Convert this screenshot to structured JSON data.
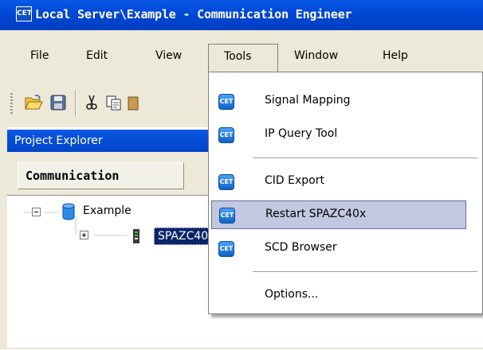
{
  "window": {
    "icon_text": "CET",
    "title": "Local Server\\Example - Communication Engineer"
  },
  "menubar": {
    "items": [
      {
        "label": "File"
      },
      {
        "label": "Edit"
      },
      {
        "label": "View"
      },
      {
        "label": "Tools"
      },
      {
        "label": "Window"
      },
      {
        "label": "Help"
      }
    ]
  },
  "toolbar": {
    "icons": [
      "open-folder-icon",
      "save-icon",
      "cut-icon",
      "copy-icon",
      "paste-icon"
    ]
  },
  "project_explorer": {
    "title": "Project Explorer",
    "close_glyph": "×",
    "tab_label": "Communication",
    "tree": [
      {
        "label": "Example",
        "expanded": true,
        "icon": "database-icon"
      },
      {
        "label": "SPAZC40x",
        "expanded": false,
        "selected": true,
        "icon": "device-icon"
      }
    ]
  },
  "tools_menu": {
    "items": [
      {
        "label": "Signal Mapping",
        "icon": "cet-icon",
        "icon_text": "CET"
      },
      {
        "label": "IP Query Tool",
        "icon": "cet-icon",
        "icon_text": "CET"
      },
      {
        "label": "CID Export",
        "icon": "cet-icon",
        "icon_text": "CET"
      },
      {
        "label": "Restart SPAZC40x",
        "icon": "cet-icon",
        "icon_text": "CET",
        "highlighted": true
      },
      {
        "label": "SCD Browser",
        "icon": "cet-icon",
        "icon_text": "CET"
      },
      {
        "label": "Options...",
        "icon": "none"
      }
    ]
  },
  "colors": {
    "title_bar": "#0047d4",
    "menu_bg": "#ece9d8",
    "highlight_bg": "#c1c8e0",
    "selection_bg": "#0a246a"
  }
}
